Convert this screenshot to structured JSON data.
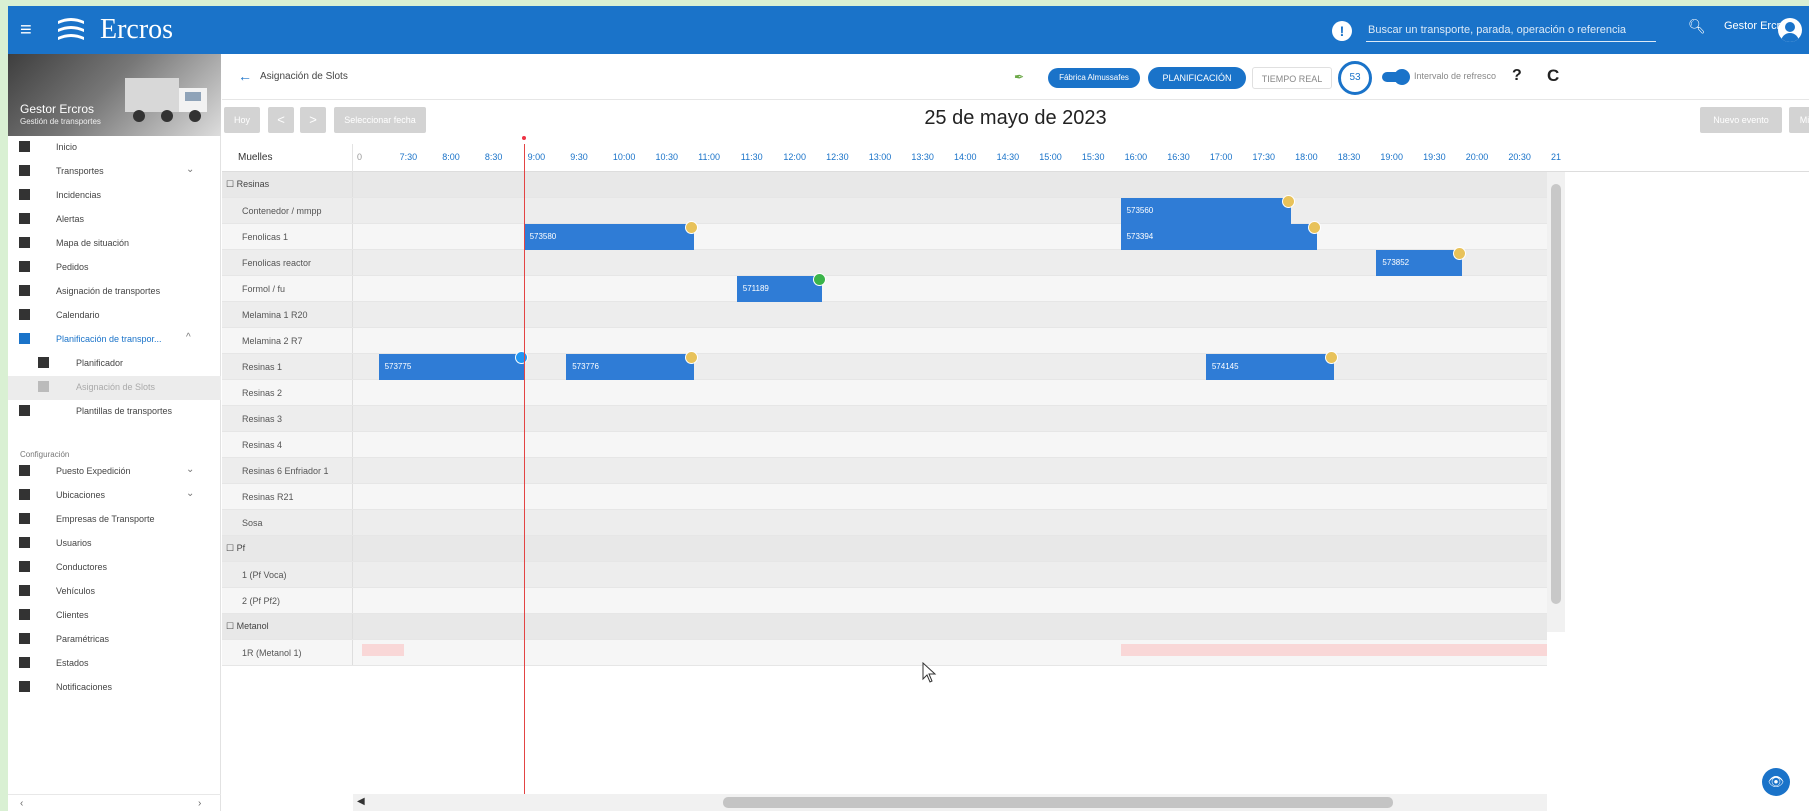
{
  "app": {
    "brand": "Ercros",
    "search_placeholder": "Buscar un transporte, parada, operación o referencia",
    "user_name": "Gestor Ercros",
    "colors": {
      "primary": "#1a73c9",
      "slot": "#2f7cd6",
      "now_line": "#e34444",
      "dot_yellow": "#e8c25a",
      "dot_green": "#3bb44a",
      "dot_blue": "#2196f3"
    }
  },
  "sidebar": {
    "user": "Gestor Ercros",
    "role": "Gestión de transportes",
    "items": [
      {
        "label": "Inicio",
        "icon": "home-icon"
      },
      {
        "label": "Transportes",
        "icon": "diamond-icon",
        "chevron": "⌄"
      },
      {
        "label": "Incidencias",
        "icon": "warning-icon"
      },
      {
        "label": "Alertas",
        "icon": "bell-icon"
      },
      {
        "label": "Mapa de situación",
        "icon": "map-icon"
      },
      {
        "label": "Pedidos",
        "icon": "orders-icon"
      },
      {
        "label": "Asignación de transportes",
        "icon": "truck-icon"
      },
      {
        "label": "Calendario",
        "icon": "calendar-icon"
      },
      {
        "label": "Planificación de transpor...",
        "icon": "planning-icon",
        "chevron": "^"
      },
      {
        "label": "Planificador",
        "icon": "planner-icon"
      },
      {
        "label": "Asignación de Slots",
        "icon": "slots-icon"
      },
      {
        "label": "Plantillas de transportes",
        "icon": "file-icon"
      }
    ],
    "config_label": "Configuración",
    "config_items": [
      {
        "label": "Puesto Expedición",
        "icon": "gear-icon",
        "chevron": "⌄"
      },
      {
        "label": "Ubicaciones",
        "icon": "location-icon",
        "chevron": "⌄"
      },
      {
        "label": "Empresas de Transporte",
        "icon": "building-icon"
      },
      {
        "label": "Usuarios",
        "icon": "users-icon"
      },
      {
        "label": "Conductores",
        "icon": "driver-icon"
      },
      {
        "label": "Vehículos",
        "icon": "vehicle-icon"
      },
      {
        "label": "Clientes",
        "icon": "clients-icon"
      },
      {
        "label": "Paramétricas",
        "icon": "table-icon"
      },
      {
        "label": "Estados",
        "icon": "list-icon"
      },
      {
        "label": "Notificaciones",
        "icon": "mail-icon"
      }
    ],
    "scroll_left": "‹",
    "scroll_right": "›"
  },
  "header": {
    "back": "←",
    "breadcrumb": "Asignación de Slots",
    "factory": "Fábrica Almussafes",
    "tab_plan": "PLANIFICACIÓN",
    "tab_real": "TIEMPO REAL",
    "countdown": "53",
    "refresh_label": "Intervalo de refresco",
    "help": "?",
    "reload": "C"
  },
  "toolbar": {
    "today": "Hoy",
    "prev": "<",
    "next": ">",
    "select_date": "Seleccionar fecha",
    "date": "25 de mayo de 2023",
    "new_event": "Nuevo evento",
    "minimize": "Minimizar"
  },
  "gantt": {
    "header_label": "Muelles",
    "start_hour": 7.0,
    "end_hour": 21.0,
    "now_hour": 9.0,
    "ticks": [
      "0",
      "7:30",
      "8:00",
      "8:30",
      "9:00",
      "9:30",
      "10:00",
      "10:30",
      "11:00",
      "11:30",
      "12:00",
      "12:30",
      "13:00",
      "13:30",
      "14:00",
      "14:30",
      "15:00",
      "15:30",
      "16:00",
      "16:30",
      "17:00",
      "17:30",
      "18:00",
      "18:30",
      "19:00",
      "19:30",
      "20:00",
      "20:30",
      "21"
    ],
    "rows": [
      {
        "label": "☐ Resinas",
        "group": true
      },
      {
        "label": "Contenedor / mmpp",
        "slots": [
          {
            "id": "573560",
            "start": 16.0,
            "end": 18.0,
            "status": "yellow"
          }
        ]
      },
      {
        "label": "Fenolicas 1",
        "slots": [
          {
            "id": "573580",
            "start": 9.0,
            "end": 11.0,
            "status": "yellow"
          },
          {
            "id": "573394",
            "start": 16.0,
            "end": 18.3,
            "status": "yellow"
          }
        ]
      },
      {
        "label": "Fenolicas reactor",
        "slots": [
          {
            "id": "573852",
            "start": 19.0,
            "end": 20.0,
            "status": "yellow"
          }
        ]
      },
      {
        "label": "Formol / fu",
        "slots": [
          {
            "id": "571189",
            "start": 11.5,
            "end": 12.5,
            "status": "green"
          }
        ]
      },
      {
        "label": "Melamina 1 R20"
      },
      {
        "label": "Melamina 2 R7"
      },
      {
        "label": "Resinas 1",
        "slots": [
          {
            "id": "573775",
            "start": 7.3,
            "end": 9.0,
            "status": "blue"
          },
          {
            "id": "573776",
            "start": 9.5,
            "end": 11.0,
            "status": "yellow"
          },
          {
            "id": "574145",
            "start": 17.0,
            "end": 18.5,
            "status": "yellow"
          }
        ]
      },
      {
        "label": "Resinas 2"
      },
      {
        "label": "Resinas 3"
      },
      {
        "label": "Resinas 4"
      },
      {
        "label": "Resinas 6 Enfriador 1"
      },
      {
        "label": "Resinas R21"
      },
      {
        "label": "Sosa"
      },
      {
        "label": "☐ Pf",
        "group": true
      },
      {
        "label": "1 (Pf Voca)"
      },
      {
        "label": "2 (Pf Pf2)"
      },
      {
        "label": "☐ Metanol",
        "group": true
      },
      {
        "label": "1R (Metanol 1)"
      }
    ],
    "view_icon": "👁",
    "save_icon": "▣",
    "hscroll_left": "◀"
  }
}
